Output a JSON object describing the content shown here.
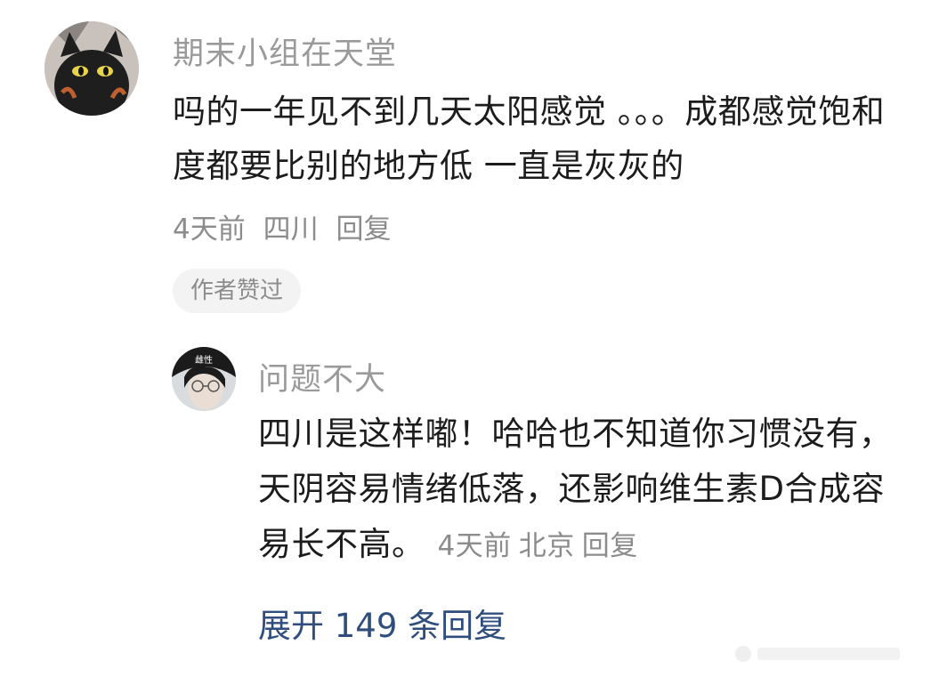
{
  "comment": {
    "username": "期末小组在天堂",
    "text": "吗的一年见不到几天太阳感觉 。。。成都感觉饱和度都要比别的地方低 一直是灰灰的",
    "time": "4天前",
    "location": "四川",
    "reply_label": "回复",
    "badge": "作者赞过"
  },
  "reply": {
    "username": "问题不大",
    "avatar_text": "雌性",
    "text": "四川是这样嘟！哈哈也不知道你习惯没有，天阴容易情绪低落，还影响维生素D合成容易长不高。",
    "time": "4天前",
    "location": "北京",
    "reply_label": "回复"
  },
  "expand_label": "展开 149 条回复",
  "colors": {
    "link": "#2f4e7d",
    "meta": "#8c8c8c",
    "username": "#9a9a9a"
  }
}
